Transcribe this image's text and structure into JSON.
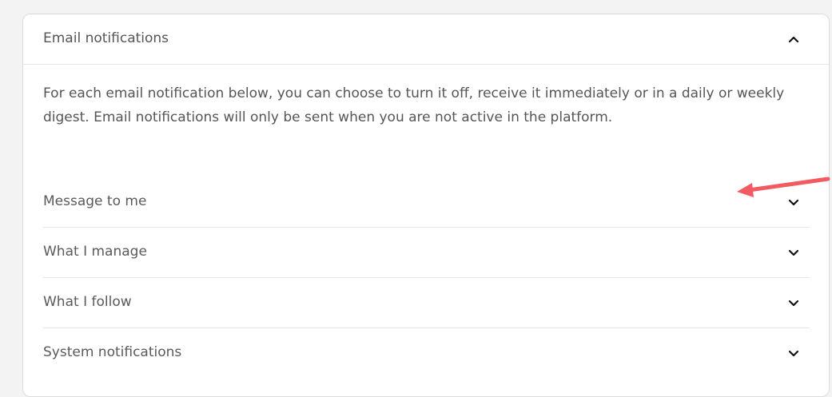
{
  "panel": {
    "title": "Email notifications",
    "description": "For each email notification below, you can choose to turn it off, receive it immediately or in a daily or weekly digest. Email notifications will only be sent when you are not active in the platform.",
    "header_icon": "chevron-up-icon",
    "items": [
      {
        "label": "Message to me",
        "icon": "chevron-down-icon"
      },
      {
        "label": "What I manage",
        "icon": "chevron-down-icon"
      },
      {
        "label": "What I follow",
        "icon": "chevron-down-icon"
      },
      {
        "label": "System notifications",
        "icon": "chevron-down-icon"
      }
    ]
  },
  "annotation": {
    "type": "arrow",
    "color": "#f15b61"
  },
  "colors": {
    "background": "#f3f3f3",
    "card": "#ffffff",
    "divider": "#e6e6e6",
    "text": "#555555"
  }
}
